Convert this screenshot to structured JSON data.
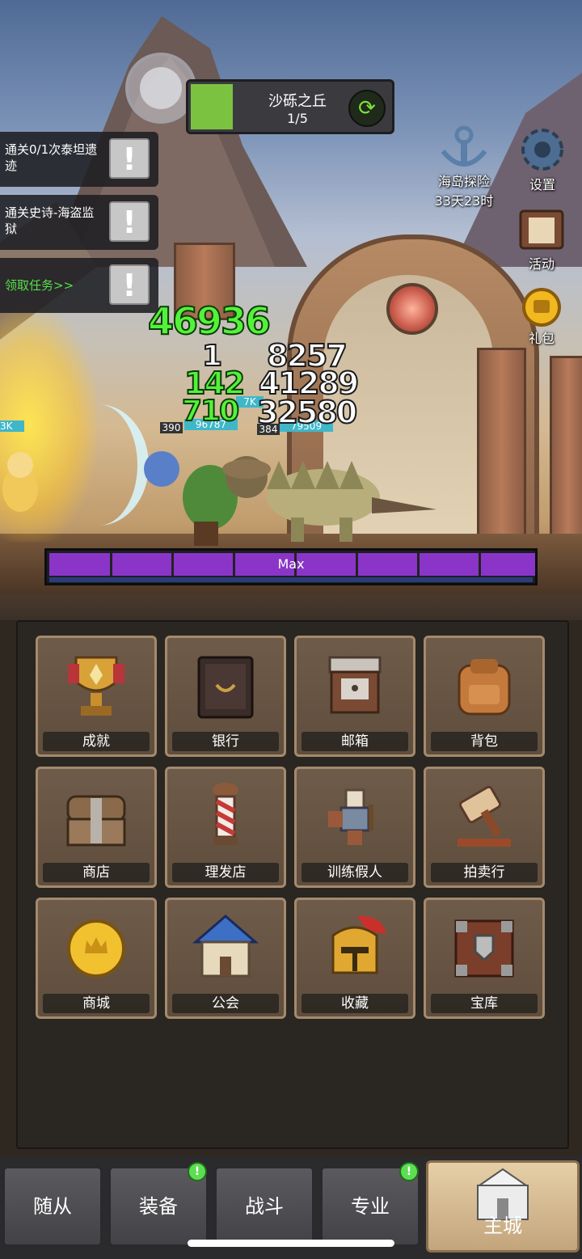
{
  "stage": {
    "name": "沙砾之丘",
    "progress": "1/5",
    "progress_fraction": 0.2
  },
  "quests": [
    {
      "text": "通关0/1次泰坦遗迹"
    },
    {
      "text": "通关史诗-海盗监狱"
    },
    {
      "text": "领取任务>>"
    }
  ],
  "quest_button_glyph": "!",
  "right_icons": {
    "island": {
      "label": "海岛探险",
      "timer": "33天23时"
    },
    "settings": {
      "label": "设置"
    },
    "activity": {
      "label": "活动"
    },
    "gift": {
      "label": "礼包"
    }
  },
  "damage": {
    "big": "46936",
    "left": [
      "1",
      "142",
      "710"
    ],
    "right": [
      "8257",
      "41289",
      "32580"
    ]
  },
  "hp_labels": {
    "left_tag": "3K",
    "a": "390",
    "b": "96787",
    "c": "7K",
    "d": "384",
    "e": "79509"
  },
  "skill_bar": {
    "label": "Max",
    "segments": 8
  },
  "menu": [
    {
      "label": "成就",
      "icon": "trophy-icon"
    },
    {
      "label": "银行",
      "icon": "safe-icon"
    },
    {
      "label": "邮箱",
      "icon": "mailbox-icon"
    },
    {
      "label": "背包",
      "icon": "backpack-icon"
    },
    {
      "label": "商店",
      "icon": "chest-icon"
    },
    {
      "label": "理发店",
      "icon": "barber-pole-icon"
    },
    {
      "label": "训练假人",
      "icon": "training-dummy-icon"
    },
    {
      "label": "拍卖行",
      "icon": "gavel-icon"
    },
    {
      "label": "商城",
      "icon": "coin-icon"
    },
    {
      "label": "公会",
      "icon": "guild-hall-icon"
    },
    {
      "label": "收藏",
      "icon": "helmet-icon"
    },
    {
      "label": "宝库",
      "icon": "vault-icon"
    }
  ],
  "nav": {
    "followers": "随从",
    "equipment": "装备",
    "battle": "战斗",
    "profession": "专业",
    "main_city": "主城",
    "badge_glyph": "!"
  },
  "colors": {
    "accent_green": "#53f23a",
    "skill_purple": "#8a35c8",
    "panel_bg": "#2a2622"
  }
}
